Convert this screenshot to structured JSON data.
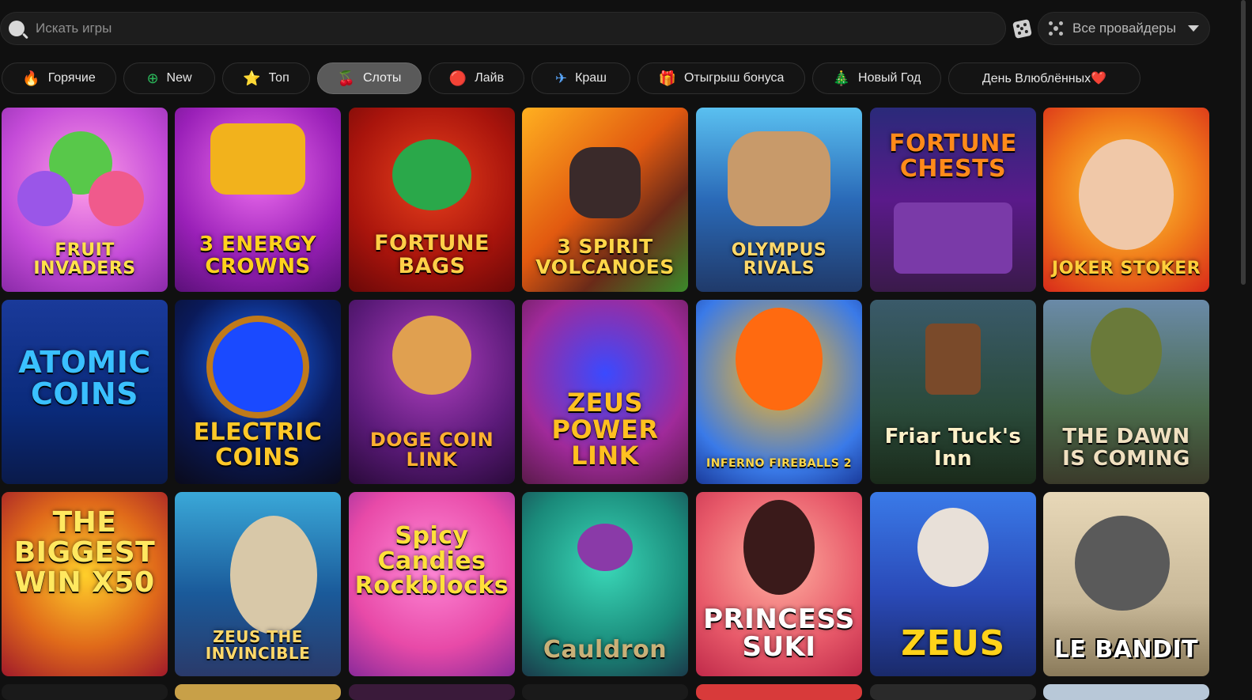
{
  "search": {
    "placeholder": "Искать игры"
  },
  "providers": {
    "label": "Все провайдеры"
  },
  "categories": [
    {
      "label": "Горячие",
      "icon": "🔥"
    },
    {
      "label": "New",
      "icon": "⊕"
    },
    {
      "label": "Топ",
      "icon": "⭐"
    },
    {
      "label": "Слоты",
      "icon": "🍒"
    },
    {
      "label": "Лайв",
      "icon": "🔴"
    },
    {
      "label": "Краш",
      "icon": "✈"
    },
    {
      "label": "Отыгрыш бонуса",
      "icon": "🎁"
    },
    {
      "label": "Новый Год",
      "icon": "🎄"
    },
    {
      "label": "День Влюблённых❤️",
      "icon": ""
    }
  ],
  "active_category": "Слоты",
  "games": [
    {
      "title": "Fruit Invaders"
    },
    {
      "title": "3 Energy Crowns"
    },
    {
      "title": "Fortune Bags"
    },
    {
      "title": "3 Spirit Volcanoes"
    },
    {
      "title": "Olympus Rivals"
    },
    {
      "title": "Fortune Chests"
    },
    {
      "title": "Joker Stoker"
    },
    {
      "title": "Atomic Coins"
    },
    {
      "title": "Electric Coins"
    },
    {
      "title": "Doge Coin Link"
    },
    {
      "title": "Zeus Power Link"
    },
    {
      "title": "Inferno Fireballs 2"
    },
    {
      "title": "Friar Tuck's Inn"
    },
    {
      "title": "The Dawn is Coming"
    },
    {
      "title": "The Biggest Win X50"
    },
    {
      "title": "Zeus the Invincible"
    },
    {
      "title": "Spicy Candies Rockblocks"
    },
    {
      "title": "Cauldron"
    },
    {
      "title": "Princess Suki"
    },
    {
      "title": "Zeus"
    },
    {
      "title": "Le Bandit"
    }
  ],
  "colors": {
    "background": "#101010",
    "pill_active": "#5a5a5a",
    "search_bg": "#1d1d1d"
  }
}
